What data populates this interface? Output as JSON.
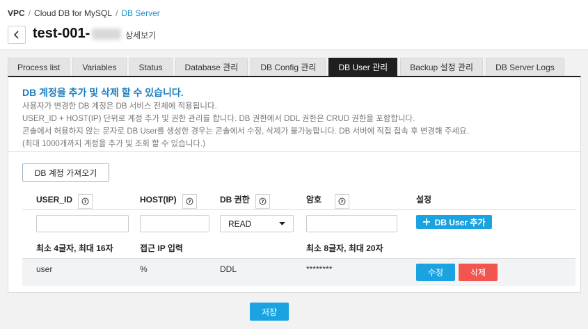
{
  "breadcrumb": [
    "VPC",
    "Cloud DB for MySQL",
    "DB Server"
  ],
  "header": {
    "title": "test-001-",
    "detail": "상세보기"
  },
  "tabs": [
    "Process list",
    "Variables",
    "Status",
    "Database 관리",
    "DB Config 관리",
    "DB User 관리",
    "Backup 설정 관리",
    "DB Server Logs"
  ],
  "active_tab": "DB User 관리",
  "info": {
    "title": "DB 계정을 추가 및 삭제 할 수 있습니다.",
    "lines": [
      "사용자가 변경한 DB 계정은 DB 서비스 전체에 적용됩니다.",
      "USER_ID + HOST(IP) 단위로 계정 추가 및 권한 관리를 합니다.   DB 권한에서 DDL 권한은 CRUD 권한을 포함합니다.",
      "콘솔에서 허용하지 않는 문자로 DB User를 생성한 경우는 콘솔에서 수정, 삭제가 불가능합니다.   DB 서버에 직접 접속 후 변경해 주세요.",
      "(최대 1000개까지 계정을 추가 및 조회 할 수 있습니다.)"
    ]
  },
  "import_button": "DB 계정 가져오기",
  "columns": {
    "user_id": "USER_ID",
    "host": "HOST(IP)",
    "privilege": "DB 권한",
    "password": "암호",
    "settings": "설정"
  },
  "form": {
    "user_id_value": "",
    "host_value": "",
    "privilege_selected": "READ",
    "password_value": "",
    "add_button": "DB User 추가"
  },
  "hints": {
    "user_id": "최소 4글자, 최대 16자",
    "host": "접근 IP 입력",
    "password": "최소 8글자, 최대 20자"
  },
  "rows": [
    {
      "user_id": "user",
      "host": "%",
      "privilege": "DDL",
      "password": "********",
      "edit": "수정",
      "delete": "삭제"
    }
  ],
  "save_button": "저장",
  "colors": {
    "accent": "#1aa3e0",
    "danger": "#f2554d",
    "title_blue": "#1a7fc2",
    "active_tab": "#1f1f1f"
  },
  "icons": {
    "back": "chevron-left-icon",
    "help": "help-circle-icon",
    "dropdown": "caret-down-icon",
    "add": "plus-icon"
  }
}
